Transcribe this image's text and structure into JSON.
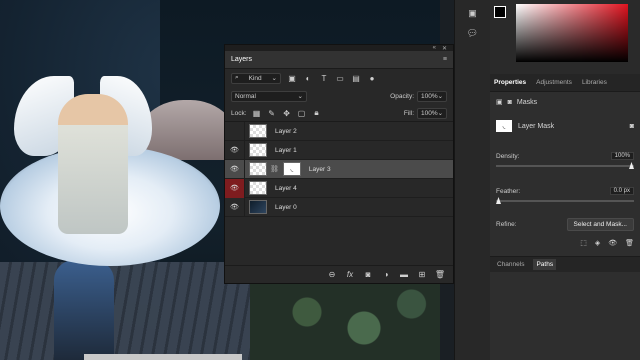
{
  "layers_panel": {
    "tab": "Layers",
    "filter": {
      "kind": "Kind"
    },
    "blend": {
      "mode": "Normal",
      "opacity_label": "Opacity:",
      "opacity_value": "100%"
    },
    "lock": {
      "label": "Lock:",
      "fill_label": "Fill:",
      "fill_value": "100%"
    },
    "layers": [
      {
        "name": "Layer 2",
        "visible": false
      },
      {
        "name": "Layer 1",
        "visible": true
      },
      {
        "name": "Layer 3",
        "visible": true,
        "selected": true
      },
      {
        "name": "Layer 4",
        "visible": true
      },
      {
        "name": "Layer 0",
        "visible": true
      }
    ],
    "bottom_fx": "fx"
  },
  "properties_panel": {
    "tabs": [
      "Properties",
      "Adjustments",
      "Libraries"
    ],
    "masks_label": "Masks",
    "layer_mask_label": "Layer Mask",
    "density_label": "Density:",
    "density_value": "100%",
    "feather_label": "Feather:",
    "feather_value": "0.0 px",
    "refine_label": "Refine:",
    "select_mask_button": "Select and Mask..."
  },
  "bottom_tabs": [
    "Channels",
    "Paths"
  ],
  "colors": {
    "foreground": "#000000",
    "background": "#ffffff",
    "accent_red": "#e0131f",
    "selected_row": "#4b4b4b"
  }
}
